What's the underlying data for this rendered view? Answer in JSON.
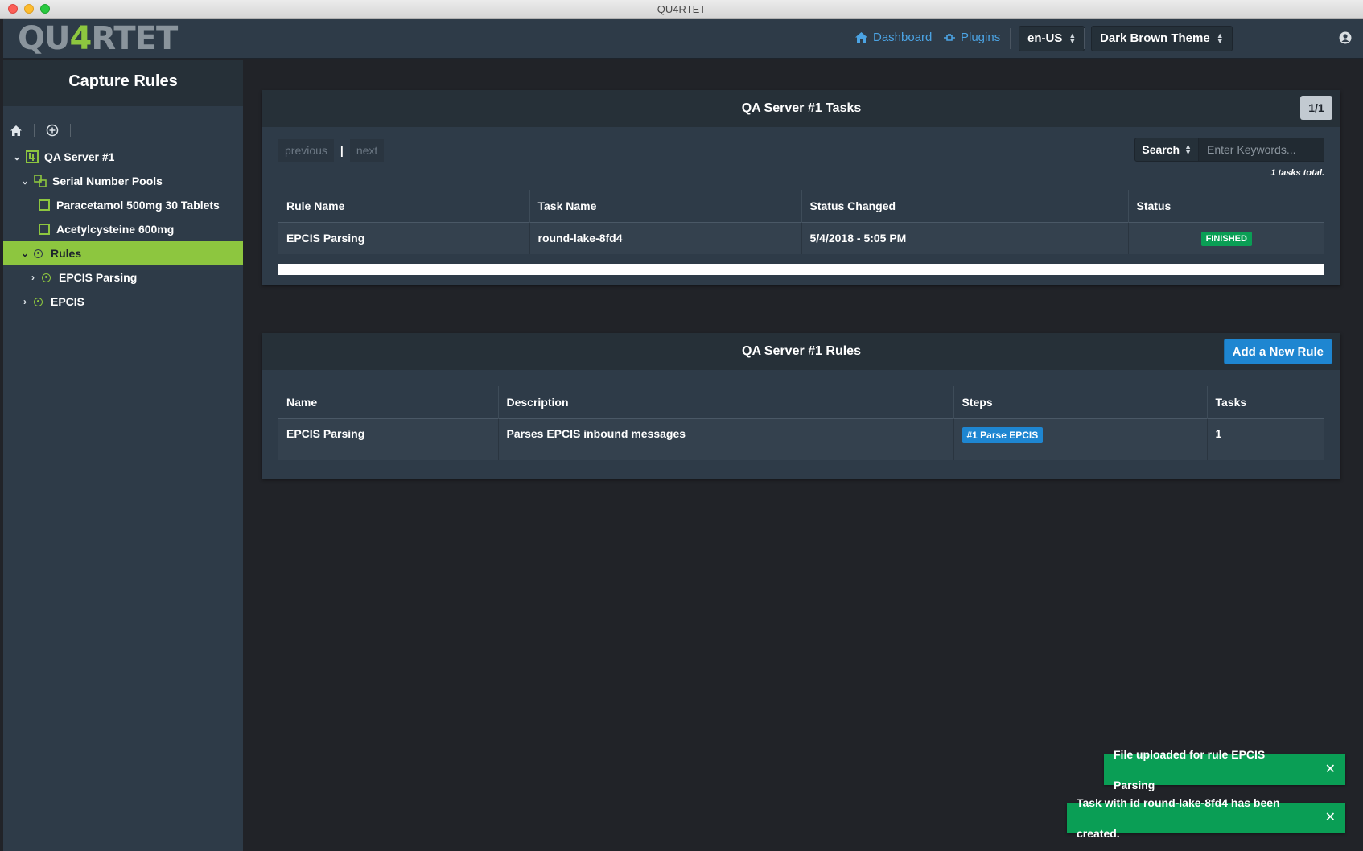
{
  "window": {
    "title": "QU4RTET"
  },
  "topnav": {
    "logo_left": "QU",
    "logo_four": "4",
    "logo_right": "RTET",
    "dashboard_label": "Dashboard",
    "plugins_label": "Plugins",
    "locale_value": "en-US",
    "theme_value": "Dark Brown Theme"
  },
  "sidebar": {
    "title": "Capture Rules",
    "tree": [
      {
        "label": "QA Server #1"
      },
      {
        "label": "Serial Number Pools"
      },
      {
        "label": "Paracetamol 500mg 30 Tablets"
      },
      {
        "label": "Acetylcysteine 600mg"
      },
      {
        "label": "Rules"
      },
      {
        "label": "EPCIS Parsing"
      },
      {
        "label": "EPCIS"
      }
    ]
  },
  "tasks_panel": {
    "title": "QA Server #1 Tasks",
    "page_indicator": "1/1",
    "previous_label": "previous",
    "separator": "|",
    "next_label": "next",
    "search_label": "Search",
    "search_placeholder": "Enter Keywords...",
    "total_text": "1 tasks total.",
    "columns": [
      "Rule Name",
      "Task Name",
      "Status Changed",
      "Status"
    ],
    "rows": [
      {
        "rule_name": "EPCIS Parsing",
        "task_name": "round-lake-8fd4",
        "status_changed": "5/4/2018 - 5:05 PM",
        "status": "FINISHED"
      }
    ]
  },
  "rules_panel": {
    "title": "QA Server #1 Rules",
    "add_button": "Add a New Rule",
    "columns": [
      "Name",
      "Description",
      "Steps",
      "Tasks"
    ],
    "rows": [
      {
        "name": "EPCIS Parsing",
        "description": "Parses EPCIS inbound messages",
        "step": "#1 Parse EPCIS",
        "tasks": "1"
      }
    ]
  },
  "toasts": [
    {
      "message": "File uploaded for rule EPCIS Parsing"
    },
    {
      "message": "Task with id round-lake-8fd4 has been created."
    }
  ],
  "colors": {
    "accent_green": "#8dc63f",
    "link_blue": "#4ba3e3",
    "success": "#0a9e55",
    "primary": "#1e86d1"
  }
}
